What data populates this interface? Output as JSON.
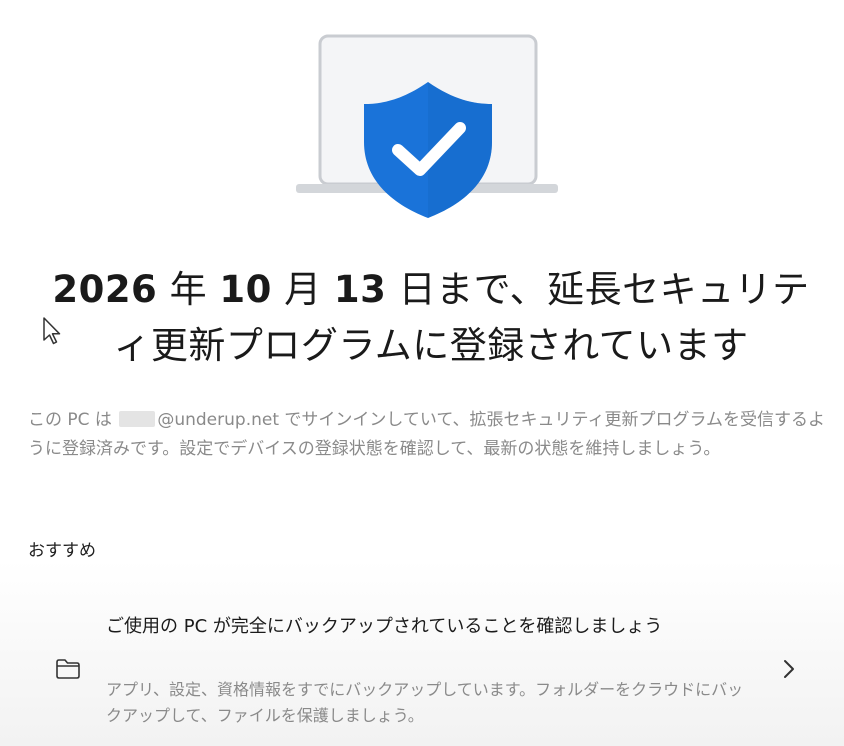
{
  "hero": {
    "icon": "shield-check-icon",
    "laptop_icon": "laptop-icon",
    "shield_color": "#1a73d9"
  },
  "title": {
    "year": "2026",
    "nen": " 年 ",
    "month": "10",
    "gatsu": " 月 ",
    "day": "13",
    "rest_line1": " 日まで、延長セキュリテ",
    "line2": "ィ更新プログラムに登録されています"
  },
  "description": {
    "prefix": "この PC は",
    "account_suffix": "@underup.net",
    "body": " でサインインしていて、拡張セキュリティ更新プログラムを受信するように登録済みです。設定でデバイスの登録状態を確認して、最新の状態を維持しましょう。"
  },
  "recommended": {
    "label": "おすすめ",
    "items": [
      {
        "icon": "folder-icon",
        "title": "ご使用の PC が完全にバックアップされていることを確認しましょう",
        "subtitle": "アプリ、設定、資格情報をすでにバックアップしています。フォルダーをクラウドにバックアップして、ファイルを保護しましょう。",
        "action_icon": "chevron-right-icon"
      }
    ]
  }
}
